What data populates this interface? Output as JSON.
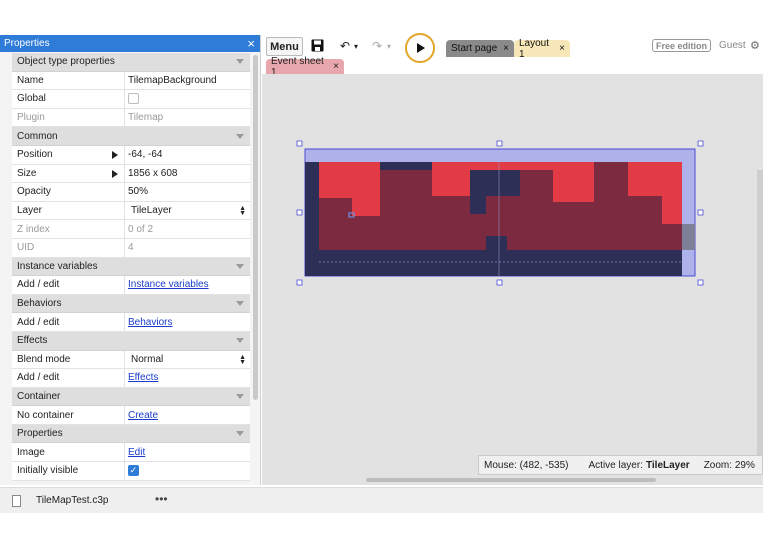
{
  "properties_panel": {
    "title": "Properties",
    "close": "×",
    "sections": {
      "object_type": "Object type properties",
      "common": "Common",
      "instance_variables": "Instance variables",
      "behaviors": "Behaviors",
      "effects": "Effects",
      "container": "Container",
      "properties": "Properties"
    },
    "rows": {
      "name": {
        "label": "Name",
        "value": "TilemapBackground"
      },
      "global": {
        "label": "Global",
        "checked": false
      },
      "plugin": {
        "label": "Plugin",
        "value": "Tilemap"
      },
      "position": {
        "label": "Position",
        "value": "-64, -64"
      },
      "size": {
        "label": "Size",
        "value": "1856 x 608"
      },
      "opacity": {
        "label": "Opacity",
        "value": "50%"
      },
      "layer": {
        "label": "Layer",
        "value": "TileLayer"
      },
      "zindex": {
        "label": "Z index",
        "value": "0 of 2"
      },
      "uid": {
        "label": "UID",
        "value": "4"
      },
      "inst_add": {
        "label": "Add / edit",
        "link": "Instance variables"
      },
      "beh_add": {
        "label": "Add / edit",
        "link": "Behaviors"
      },
      "blend": {
        "label": "Blend mode",
        "value": "Normal"
      },
      "eff_add": {
        "label": "Add / edit",
        "link": "Effects"
      },
      "no_container": {
        "label": "No container",
        "link": "Create"
      },
      "image": {
        "label": "Image",
        "link": "Edit"
      },
      "visible": {
        "label": "Initially visible",
        "checked": true
      }
    }
  },
  "toolbar": {
    "menu": "Menu",
    "tabs": {
      "start": "Start page",
      "layout": "Layout 1",
      "event": "Event sheet 1"
    },
    "free_edition": "Free edition",
    "guest": "Guest"
  },
  "status": {
    "mouse": "Mouse: (482, -535)",
    "active_layer_label": "Active layer:",
    "active_layer": "TileLayer",
    "zoom": "Zoom: 29%"
  },
  "file": {
    "name": "TileMapTest.c3p",
    "more": "•••"
  },
  "colors": {
    "accent": "#2f7bd8",
    "tile_red": "#e33b45",
    "tile_dark": "#7b2a40",
    "selection": "#4b4bd6"
  }
}
